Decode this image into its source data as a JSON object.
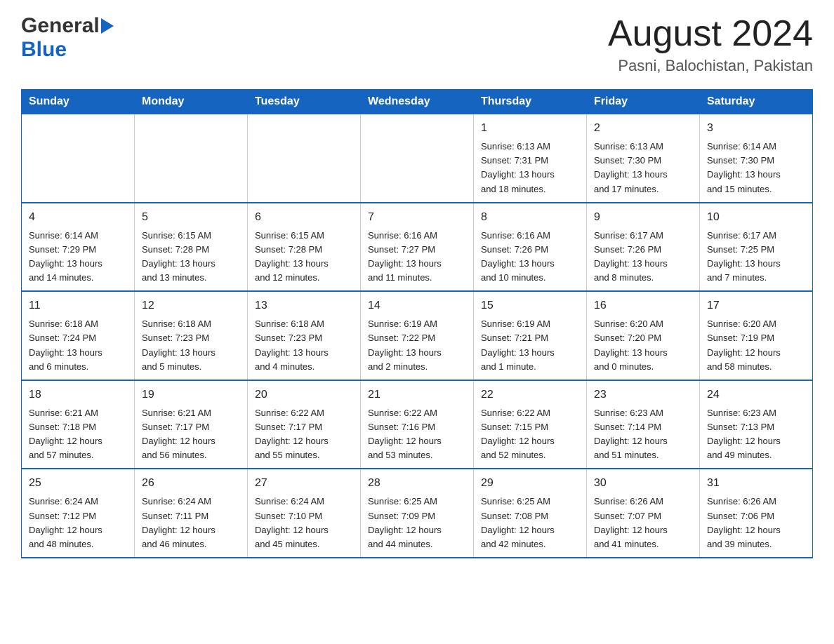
{
  "header": {
    "logo_general": "General",
    "logo_blue": "Blue",
    "month_title": "August 2024",
    "location": "Pasni, Balochistan, Pakistan"
  },
  "days_of_week": [
    "Sunday",
    "Monday",
    "Tuesday",
    "Wednesday",
    "Thursday",
    "Friday",
    "Saturday"
  ],
  "weeks": [
    [
      {
        "day": "",
        "info": ""
      },
      {
        "day": "",
        "info": ""
      },
      {
        "day": "",
        "info": ""
      },
      {
        "day": "",
        "info": ""
      },
      {
        "day": "1",
        "info": "Sunrise: 6:13 AM\nSunset: 7:31 PM\nDaylight: 13 hours\nand 18 minutes."
      },
      {
        "day": "2",
        "info": "Sunrise: 6:13 AM\nSunset: 7:30 PM\nDaylight: 13 hours\nand 17 minutes."
      },
      {
        "day": "3",
        "info": "Sunrise: 6:14 AM\nSunset: 7:30 PM\nDaylight: 13 hours\nand 15 minutes."
      }
    ],
    [
      {
        "day": "4",
        "info": "Sunrise: 6:14 AM\nSunset: 7:29 PM\nDaylight: 13 hours\nand 14 minutes."
      },
      {
        "day": "5",
        "info": "Sunrise: 6:15 AM\nSunset: 7:28 PM\nDaylight: 13 hours\nand 13 minutes."
      },
      {
        "day": "6",
        "info": "Sunrise: 6:15 AM\nSunset: 7:28 PM\nDaylight: 13 hours\nand 12 minutes."
      },
      {
        "day": "7",
        "info": "Sunrise: 6:16 AM\nSunset: 7:27 PM\nDaylight: 13 hours\nand 11 minutes."
      },
      {
        "day": "8",
        "info": "Sunrise: 6:16 AM\nSunset: 7:26 PM\nDaylight: 13 hours\nand 10 minutes."
      },
      {
        "day": "9",
        "info": "Sunrise: 6:17 AM\nSunset: 7:26 PM\nDaylight: 13 hours\nand 8 minutes."
      },
      {
        "day": "10",
        "info": "Sunrise: 6:17 AM\nSunset: 7:25 PM\nDaylight: 13 hours\nand 7 minutes."
      }
    ],
    [
      {
        "day": "11",
        "info": "Sunrise: 6:18 AM\nSunset: 7:24 PM\nDaylight: 13 hours\nand 6 minutes."
      },
      {
        "day": "12",
        "info": "Sunrise: 6:18 AM\nSunset: 7:23 PM\nDaylight: 13 hours\nand 5 minutes."
      },
      {
        "day": "13",
        "info": "Sunrise: 6:18 AM\nSunset: 7:23 PM\nDaylight: 13 hours\nand 4 minutes."
      },
      {
        "day": "14",
        "info": "Sunrise: 6:19 AM\nSunset: 7:22 PM\nDaylight: 13 hours\nand 2 minutes."
      },
      {
        "day": "15",
        "info": "Sunrise: 6:19 AM\nSunset: 7:21 PM\nDaylight: 13 hours\nand 1 minute."
      },
      {
        "day": "16",
        "info": "Sunrise: 6:20 AM\nSunset: 7:20 PM\nDaylight: 13 hours\nand 0 minutes."
      },
      {
        "day": "17",
        "info": "Sunrise: 6:20 AM\nSunset: 7:19 PM\nDaylight: 12 hours\nand 58 minutes."
      }
    ],
    [
      {
        "day": "18",
        "info": "Sunrise: 6:21 AM\nSunset: 7:18 PM\nDaylight: 12 hours\nand 57 minutes."
      },
      {
        "day": "19",
        "info": "Sunrise: 6:21 AM\nSunset: 7:17 PM\nDaylight: 12 hours\nand 56 minutes."
      },
      {
        "day": "20",
        "info": "Sunrise: 6:22 AM\nSunset: 7:17 PM\nDaylight: 12 hours\nand 55 minutes."
      },
      {
        "day": "21",
        "info": "Sunrise: 6:22 AM\nSunset: 7:16 PM\nDaylight: 12 hours\nand 53 minutes."
      },
      {
        "day": "22",
        "info": "Sunrise: 6:22 AM\nSunset: 7:15 PM\nDaylight: 12 hours\nand 52 minutes."
      },
      {
        "day": "23",
        "info": "Sunrise: 6:23 AM\nSunset: 7:14 PM\nDaylight: 12 hours\nand 51 minutes."
      },
      {
        "day": "24",
        "info": "Sunrise: 6:23 AM\nSunset: 7:13 PM\nDaylight: 12 hours\nand 49 minutes."
      }
    ],
    [
      {
        "day": "25",
        "info": "Sunrise: 6:24 AM\nSunset: 7:12 PM\nDaylight: 12 hours\nand 48 minutes."
      },
      {
        "day": "26",
        "info": "Sunrise: 6:24 AM\nSunset: 7:11 PM\nDaylight: 12 hours\nand 46 minutes."
      },
      {
        "day": "27",
        "info": "Sunrise: 6:24 AM\nSunset: 7:10 PM\nDaylight: 12 hours\nand 45 minutes."
      },
      {
        "day": "28",
        "info": "Sunrise: 6:25 AM\nSunset: 7:09 PM\nDaylight: 12 hours\nand 44 minutes."
      },
      {
        "day": "29",
        "info": "Sunrise: 6:25 AM\nSunset: 7:08 PM\nDaylight: 12 hours\nand 42 minutes."
      },
      {
        "day": "30",
        "info": "Sunrise: 6:26 AM\nSunset: 7:07 PM\nDaylight: 12 hours\nand 41 minutes."
      },
      {
        "day": "31",
        "info": "Sunrise: 6:26 AM\nSunset: 7:06 PM\nDaylight: 12 hours\nand 39 minutes."
      }
    ]
  ]
}
